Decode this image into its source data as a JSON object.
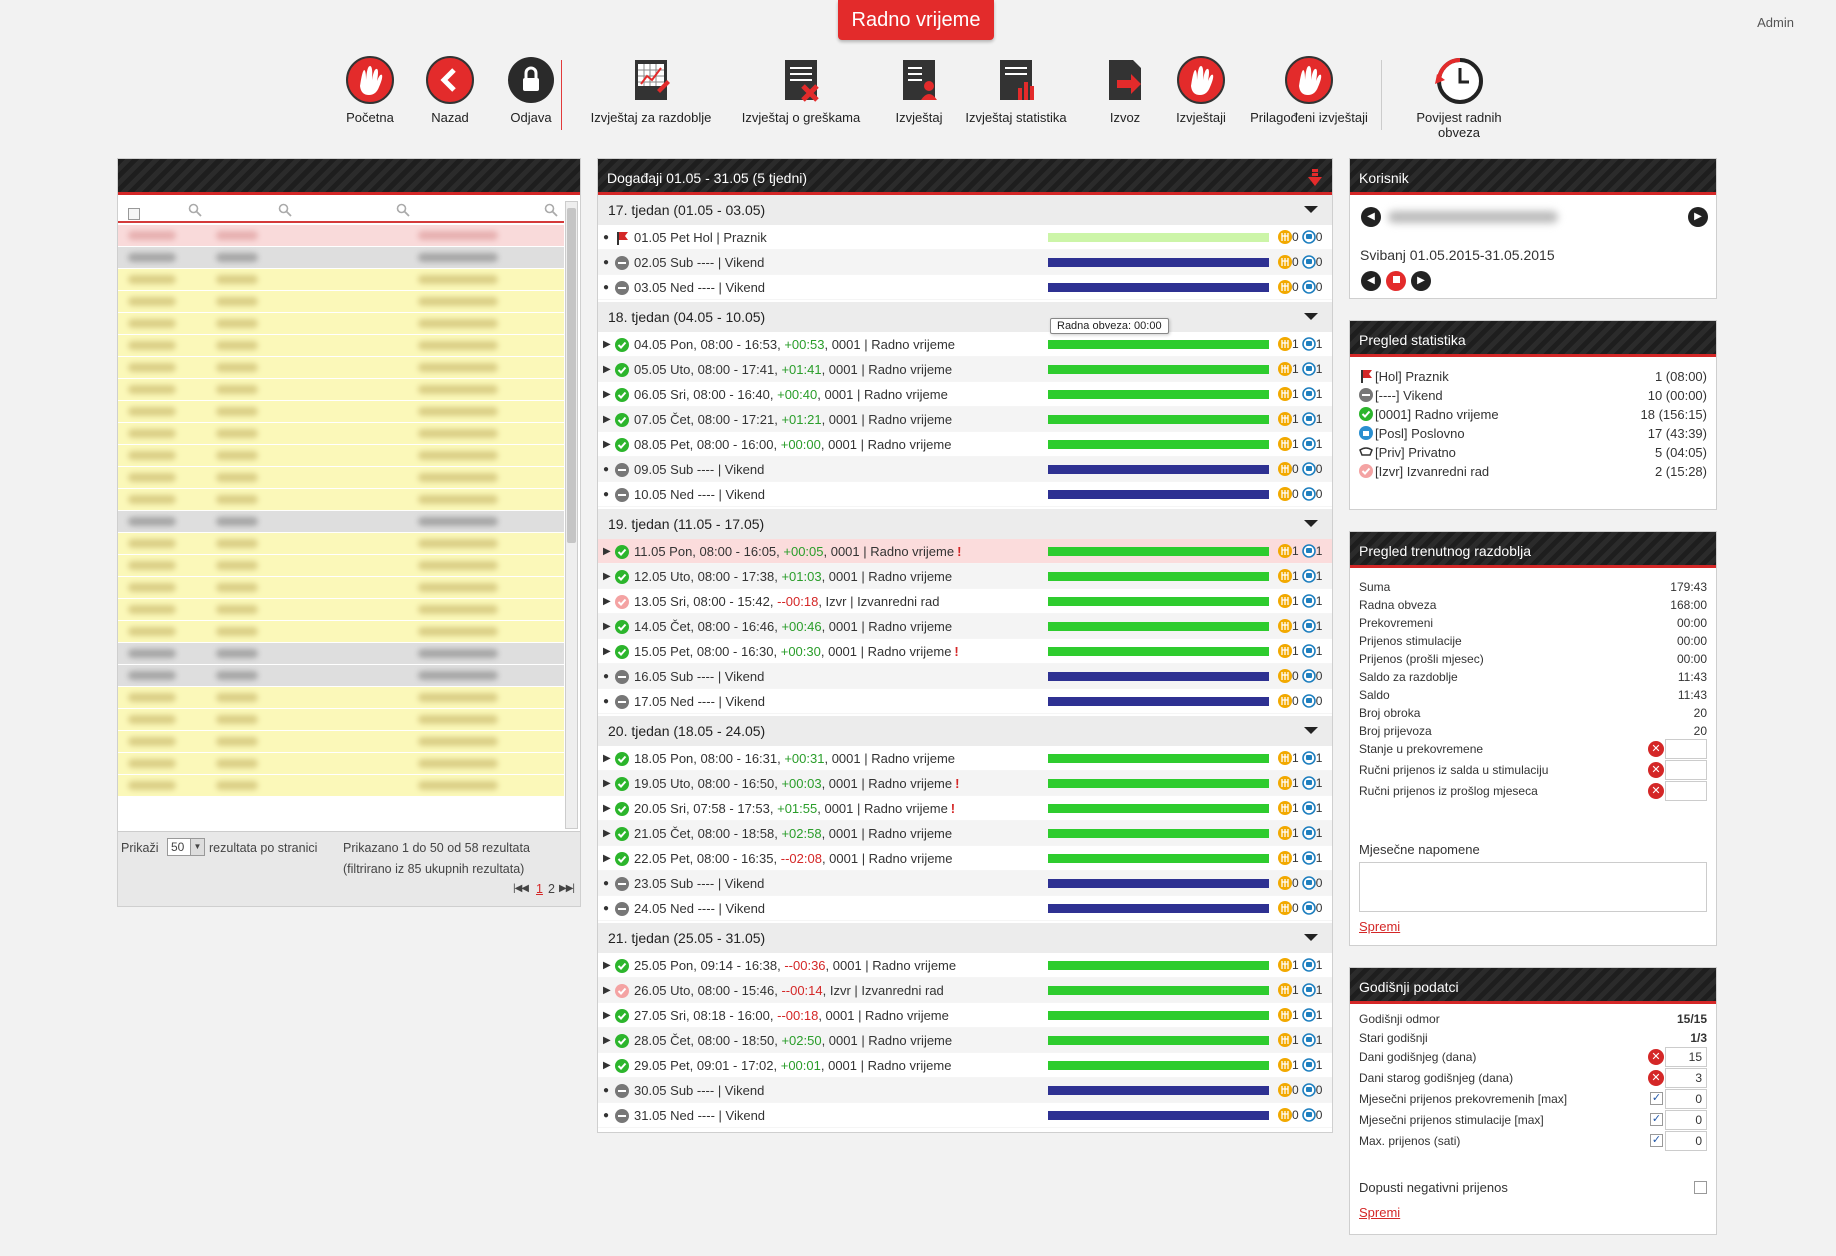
{
  "header": {
    "title": "Radno vrijeme",
    "user": "Admin"
  },
  "toolbar": [
    {
      "label": "Početna",
      "icon": "home-hand-icon"
    },
    {
      "label": "Nazad",
      "icon": "back-icon"
    },
    {
      "label": "Odjava",
      "icon": "lock-icon"
    },
    {
      "label": "Izvještaj za razdoblje",
      "icon": "report-period-icon"
    },
    {
      "label": "Izvještaj o greškama",
      "icon": "error-report-icon"
    },
    {
      "label": "Izvještaj",
      "icon": "report-icon"
    },
    {
      "label": "Izvještaj statistika",
      "icon": "statistics-report-icon"
    },
    {
      "label": "Izvoz",
      "icon": "export-icon"
    },
    {
      "label": "Izvještaji",
      "icon": "reports-icon"
    },
    {
      "label": "Prilagođeni izvještaji",
      "icon": "custom-reports-icon"
    },
    {
      "label": "Povijest radnih obveza",
      "icon": "clock-history-icon"
    }
  ],
  "left_table": {
    "footer": {
      "show_pre": "Prikaži",
      "page_size": "50",
      "show_post": "rezultata po stranici",
      "info1": "Prikazano 1 do 50 od 58 rezultata",
      "info2": "(filtrirano iz 85 ukupnih rezultata)",
      "page1": "1",
      "page2": "2"
    }
  },
  "events": {
    "title": "Događaji 01.05 - 31.05 (5 tjedni)",
    "tooltip": "Radna obveza: 00:00",
    "weeks": [
      {
        "label": "17. tjedan (01.05 - 03.05)",
        "rows": [
          {
            "d": "01.05 Pet Hol | Praznik",
            "st": "hol",
            "bar": "lightgreen",
            "m": "0",
            "t": "0"
          },
          {
            "d": "02.05 Sub ---- | Vikend",
            "st": "grey",
            "bar": "navy",
            "m": "0",
            "t": "0"
          },
          {
            "d": "03.05 Ned ---- | Vikend",
            "st": "grey",
            "bar": "navy",
            "m": "0",
            "t": "0"
          }
        ]
      },
      {
        "label": "18. tjedan (04.05 - 10.05)",
        "rows": [
          {
            "a": "04.05 Pon, 08:00 - 16:53, ",
            "diff": "+00:53",
            "dc": "g",
            "b": ", 0001 | Radno vrijeme",
            "st": "ok",
            "bar": "green",
            "m": "1",
            "t": "1"
          },
          {
            "a": "05.05 Uto, 08:00 - 17:41, ",
            "diff": "+01:41",
            "dc": "g",
            "b": ", 0001 | Radno vrijeme",
            "st": "ok",
            "bar": "green",
            "m": "1",
            "t": "1"
          },
          {
            "a": "06.05 Sri, 08:00 - 16:40, ",
            "diff": "+00:40",
            "dc": "g",
            "b": ", 0001 | Radno vrijeme",
            "st": "ok",
            "bar": "green",
            "m": "1",
            "t": "1"
          },
          {
            "a": "07.05 Čet, 08:00 - 17:21, ",
            "diff": "+01:21",
            "dc": "g",
            "b": ", 0001 | Radno vrijeme",
            "st": "ok",
            "bar": "green",
            "m": "1",
            "t": "1"
          },
          {
            "a": "08.05 Pet, 08:00 - 16:00, ",
            "diff": "+00:00",
            "dc": "g",
            "b": ", 0001 | Radno vrijeme",
            "st": "ok",
            "bar": "green",
            "m": "1",
            "t": "1"
          },
          {
            "d": "09.05 Sub ---- | Vikend",
            "st": "grey",
            "bar": "navy",
            "m": "0",
            "t": "0"
          },
          {
            "d": "10.05 Ned ---- | Vikend",
            "st": "grey",
            "bar": "navy",
            "m": "0",
            "t": "0"
          }
        ]
      },
      {
        "label": "19. tjedan (11.05 - 17.05)",
        "rows": [
          {
            "a": "11.05 Pon, 08:00 - 16:05, ",
            "diff": "+00:05",
            "dc": "g",
            "b": ", 0001 | Radno vrijeme",
            "warn": "!",
            "st": "ok",
            "bar": "green",
            "m": "1",
            "t": "1",
            "hl": true
          },
          {
            "a": "12.05 Uto, 08:00 - 17:38, ",
            "diff": "+01:03",
            "dc": "g",
            "b": ", 0001 | Radno vrijeme",
            "st": "ok",
            "bar": "green",
            "m": "1",
            "t": "1"
          },
          {
            "a": "13.05 Sri, 08:00 - 15:42, ",
            "diff": "--00:18",
            "dc": "r",
            "b": ", Izvr | Izvanredni rad",
            "st": "pink",
            "bar": "green",
            "m": "1",
            "t": "1"
          },
          {
            "a": "14.05 Čet, 08:00 - 16:46, ",
            "diff": "+00:46",
            "dc": "g",
            "b": ", 0001 | Radno vrijeme",
            "st": "ok",
            "bar": "green",
            "m": "1",
            "t": "1"
          },
          {
            "a": "15.05 Pet, 08:00 - 16:30, ",
            "diff": "+00:30",
            "dc": "g",
            "b": ", 0001 | Radno vrijeme",
            "warn": "!",
            "st": "ok",
            "bar": "green",
            "m": "1",
            "t": "1"
          },
          {
            "d": "16.05 Sub ---- | Vikend",
            "st": "grey",
            "bar": "navy",
            "m": "0",
            "t": "0"
          },
          {
            "d": "17.05 Ned ---- | Vikend",
            "st": "grey",
            "bar": "navy",
            "m": "0",
            "t": "0"
          }
        ]
      },
      {
        "label": "20. tjedan (18.05 - 24.05)",
        "rows": [
          {
            "a": "18.05 Pon, 08:00 - 16:31, ",
            "diff": "+00:31",
            "dc": "g",
            "b": ", 0001 | Radno vrijeme",
            "st": "ok",
            "bar": "green",
            "m": "1",
            "t": "1"
          },
          {
            "a": "19.05 Uto, 08:00 - 16:50, ",
            "diff": "+00:03",
            "dc": "g",
            "b": ", 0001 | Radno vrijeme",
            "warn": "!",
            "st": "ok",
            "bar": "green",
            "m": "1",
            "t": "1"
          },
          {
            "a": "20.05 Sri, 07:58 - 17:53, ",
            "diff": "+01:55",
            "dc": "g",
            "b": ", 0001 | Radno vrijeme",
            "warn": "!",
            "st": "ok",
            "bar": "green",
            "m": "1",
            "t": "1"
          },
          {
            "a": "21.05 Čet, 08:00 - 18:58, ",
            "diff": "+02:58",
            "dc": "g",
            "b": ", 0001 | Radno vrijeme",
            "st": "ok",
            "bar": "green",
            "m": "1",
            "t": "1"
          },
          {
            "a": "22.05 Pet, 08:00 - 16:35, ",
            "diff": "--02:08",
            "dc": "r",
            "b": ", 0001 | Radno vrijeme",
            "st": "ok",
            "bar": "green",
            "m": "1",
            "t": "1"
          },
          {
            "d": "23.05 Sub ---- | Vikend",
            "st": "grey",
            "bar": "navy",
            "m": "0",
            "t": "0"
          },
          {
            "d": "24.05 Ned ---- | Vikend",
            "st": "grey",
            "bar": "navy",
            "m": "0",
            "t": "0"
          }
        ]
      },
      {
        "label": "21. tjedan (25.05 - 31.05)",
        "rows": [
          {
            "a": "25.05 Pon, 09:14 - 16:38, ",
            "diff": "--00:36",
            "dc": "r",
            "b": ", 0001 | Radno vrijeme",
            "st": "ok",
            "bar": "green",
            "m": "1",
            "t": "1"
          },
          {
            "a": "26.05 Uto, 08:00 - 15:46, ",
            "diff": "--00:14",
            "dc": "r",
            "b": ", Izvr | Izvanredni rad",
            "st": "pink",
            "bar": "green",
            "m": "1",
            "t": "1"
          },
          {
            "a": "27.05 Sri, 08:18 - 16:00, ",
            "diff": "--00:18",
            "dc": "r",
            "b": ", 0001 | Radno vrijeme",
            "st": "ok",
            "bar": "green",
            "m": "1",
            "t": "1"
          },
          {
            "a": "28.05 Čet, 08:00 - 18:50, ",
            "diff": "+02:50",
            "dc": "g",
            "b": ", 0001 | Radno vrijeme",
            "st": "ok",
            "bar": "green",
            "m": "1",
            "t": "1"
          },
          {
            "a": "29.05 Pet, 09:01 - 17:02, ",
            "diff": "+00:01",
            "dc": "g",
            "b": ", 0001 | Radno vrijeme",
            "st": "ok",
            "bar": "green",
            "m": "1",
            "t": "1"
          },
          {
            "d": "30.05 Sub ---- | Vikend",
            "st": "grey",
            "bar": "navy",
            "m": "0",
            "t": "0"
          },
          {
            "d": "31.05 Ned ---- | Vikend",
            "st": "grey",
            "bar": "navy",
            "m": "0",
            "t": "0"
          }
        ]
      }
    ]
  },
  "korisnik": {
    "title": "Korisnik",
    "period": "Svibanj 01.05.2015-31.05.2015"
  },
  "stats": {
    "title": "Pregled statistika",
    "rows": [
      {
        "label": "[Hol] Praznik",
        "value": "1 (08:00)",
        "icon": "flag-icon"
      },
      {
        "label": "[----] Vikend",
        "value": "10 (00:00)",
        "icon": "minus-circle-icon"
      },
      {
        "label": "[0001] Radno vrijeme",
        "value": "18 (156:15)",
        "icon": "check-circle-icon"
      },
      {
        "label": "[Posl] Poslovno",
        "value": "17 (43:39)",
        "icon": "business-icon"
      },
      {
        "label": "[Priv] Privatno",
        "value": "5 (04:05)",
        "icon": "private-icon"
      },
      {
        "label": "[Izvr] Izvanredni rad",
        "value": "2 (15:28)",
        "icon": "overtime-icon"
      }
    ]
  },
  "period": {
    "title": "Pregled trenutnog razdoblja",
    "rows": [
      {
        "label": "Suma",
        "value": "179:43"
      },
      {
        "label": "Radna obveza",
        "value": "168:00"
      },
      {
        "label": "Prekovremeni",
        "value": "00:00"
      },
      {
        "label": "Prijenos stimulacije",
        "value": "00:00"
      },
      {
        "label": "Prijenos (prošli mjesec)",
        "value": "00:00"
      },
      {
        "label": "Saldo za razdoblje",
        "value": "11:43"
      },
      {
        "label": "Saldo",
        "value": "11:43"
      },
      {
        "label": "Broj obroka",
        "value": "20"
      },
      {
        "label": "Broj prijevoza",
        "value": "20"
      }
    ],
    "inputs": [
      {
        "label": "Stanje u prekovremene"
      },
      {
        "label": "Ručni prijenos iz salda u stimulaciju"
      },
      {
        "label": "Ručni prijenos iz prošlog mjeseca"
      }
    ],
    "notes_label": "Mjesečne napomene",
    "save": "Spremi"
  },
  "annual": {
    "title": "Godišnji podatci",
    "rows": [
      {
        "label": "Godišnji odmor",
        "value": "15/15"
      },
      {
        "label": "Stari godišnji",
        "value": "1/3"
      }
    ],
    "inputs": [
      {
        "label": "Dani godišnjeg (dana)",
        "value": "15",
        "ctrl": "x"
      },
      {
        "label": "Dani starog godišnjeg (dana)",
        "value": "3",
        "ctrl": "x"
      },
      {
        "label": "Mjesečni prijenos prekovremenih [max]",
        "value": "0",
        "ctrl": "check"
      },
      {
        "label": "Mjesečni prijenos stimulacije [max]",
        "value": "0",
        "ctrl": "check"
      },
      {
        "label": "Max. prijenos (sati)",
        "value": "0",
        "ctrl": "check"
      }
    ],
    "last": "Dopusti negativni prijenos",
    "save": "Spremi"
  }
}
